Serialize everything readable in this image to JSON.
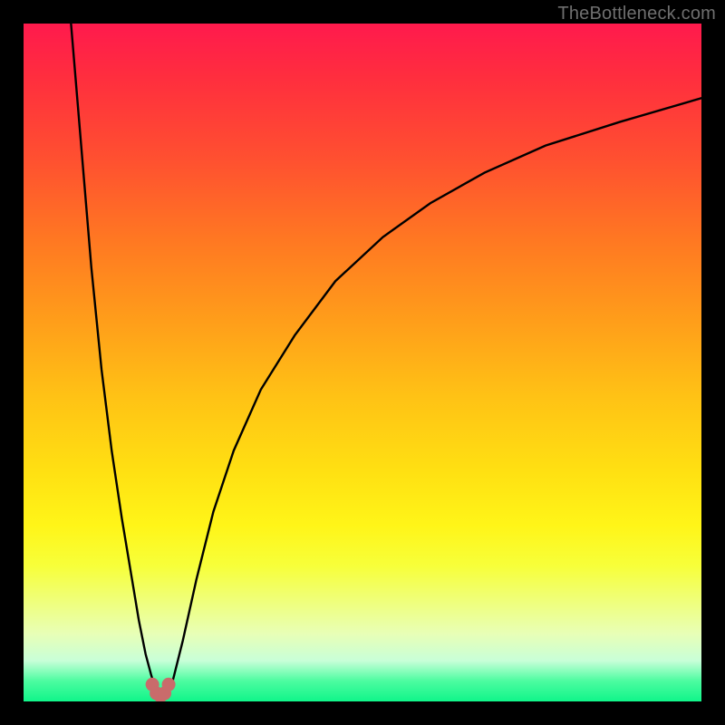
{
  "watermark": "TheBottleneck.com",
  "colors": {
    "frame": "#000000",
    "curve": "#000000",
    "marker": "#c96b6b",
    "watermark": "#6f6f6f"
  },
  "chart_data": {
    "type": "line",
    "title": "",
    "xlabel": "",
    "ylabel": "",
    "xlim": [
      0,
      100
    ],
    "ylim": [
      0,
      100
    ],
    "grid": false,
    "legend": false,
    "series": [
      {
        "name": "left-branch",
        "x": [
          7.0,
          8.0,
          9.0,
          10.0,
          11.5,
          13.0,
          14.5,
          16.0,
          17.0,
          18.0,
          18.8,
          19.4,
          19.8
        ],
        "y": [
          100.0,
          88.0,
          76.0,
          64.0,
          49.0,
          37.0,
          27.0,
          18.0,
          12.0,
          7.0,
          4.0,
          2.0,
          0.5
        ]
      },
      {
        "name": "right-branch",
        "x": [
          21.0,
          22.0,
          23.5,
          25.5,
          28.0,
          31.0,
          35.0,
          40.0,
          46.0,
          53.0,
          60.0,
          68.0,
          77.0,
          88.0,
          100.0
        ],
        "y": [
          0.5,
          3.0,
          9.0,
          18.0,
          28.0,
          37.0,
          46.0,
          54.0,
          62.0,
          68.5,
          73.5,
          78.0,
          82.0,
          85.5,
          89.0
        ]
      }
    ],
    "markers": {
      "name": "minimum-markers",
      "x": [
        19.0,
        19.6,
        20.2,
        20.8,
        21.4
      ],
      "y": [
        2.5,
        1.2,
        0.8,
        1.2,
        2.5
      ]
    }
  }
}
